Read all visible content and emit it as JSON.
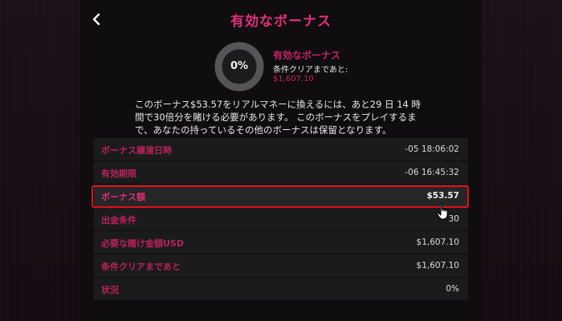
{
  "header": {
    "title": "有効なボーナス",
    "back_icon": "chevron-left-icon"
  },
  "summary": {
    "progress_percent_label": "0%",
    "progress_fraction": 0,
    "title": "有効なボーナス",
    "subtitle": "条件クリアまであと:",
    "amount": "$1,607.10"
  },
  "description": {
    "lines": [
      "このボーナス$53.57をリアルマネーに換えるには、あと29 日 14 時",
      "間で30倍分を賭ける必要があります。 このボーナスをプレイするま",
      "で、あなたの持っているその他のボーナスは保留となります。"
    ]
  },
  "details": {
    "rows": [
      {
        "label": "ボーナス譲渡日時",
        "value": "-05 18:06:02"
      },
      {
        "label": "有効期限",
        "value": "-06 16:45:32"
      },
      {
        "label": "ボーナス額",
        "value": "$53.57"
      },
      {
        "label": "出金条件",
        "value": "30"
      },
      {
        "label": "必要な賭け金額USD",
        "value": "$1,607.10"
      },
      {
        "label": "条件クリアまであと",
        "value": "$1,607.10"
      },
      {
        "label": "状況",
        "value": "0%"
      }
    ],
    "highlighted_row": "ボーナス額"
  },
  "colors": {
    "accent": "#e0307a",
    "highlight_border": "#e0101c",
    "panel": "#0f0d0f",
    "row_bg": "#1b1b1c"
  }
}
